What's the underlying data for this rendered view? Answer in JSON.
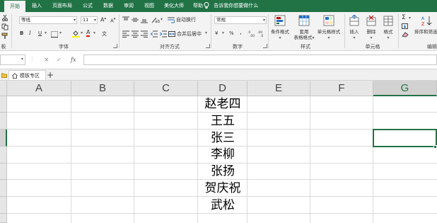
{
  "tabs": [
    "开始",
    "插入",
    "页面布局",
    "公式",
    "数据",
    "审阅",
    "视图",
    "美化大师",
    "帮助"
  ],
  "tell_me": "告诉我你想要做什么",
  "font": {
    "name": "等线",
    "size": "11"
  },
  "number_format": "常规",
  "ribbon": {
    "wrap_text": "自动换行",
    "merge_center": "合并后居中",
    "conditional_format": "条件格式",
    "table_format_line1": "套用",
    "table_format_line2": "表格格式",
    "cell_styles": "单元格样式",
    "insert": "插入",
    "delete": "删除",
    "format": "格式",
    "sort_filter": "排序和筛选",
    "group_clipboard": "板",
    "group_font": "字体",
    "group_alignment": "对齐方式",
    "group_number": "数字",
    "group_styles": "样式",
    "group_cells": "单元格",
    "group_editing": "编辑",
    "percent": "%",
    "comma": ",",
    "fx": "fx",
    "cancel": "×",
    "confirm": "✓",
    "bold": "B",
    "italic": "I",
    "underline": "U",
    "grow_font": "A",
    "shrink_font": "A",
    "font_color": "A",
    "currency": "¥",
    "sigma": "Σ"
  },
  "file_tab": "模板专区",
  "add_tab": "+",
  "columns": [
    "A",
    "B",
    "C",
    "D",
    "E",
    "F",
    "G"
  ],
  "cells_d": [
    "赵老四",
    "王五",
    "张三",
    "李柳",
    "张扬",
    "贺庆祝",
    "武松"
  ],
  "colors": {
    "accent": "#217346",
    "ribbon_bg": "#f3f3f3",
    "header_bg": "#e6e6e6"
  }
}
